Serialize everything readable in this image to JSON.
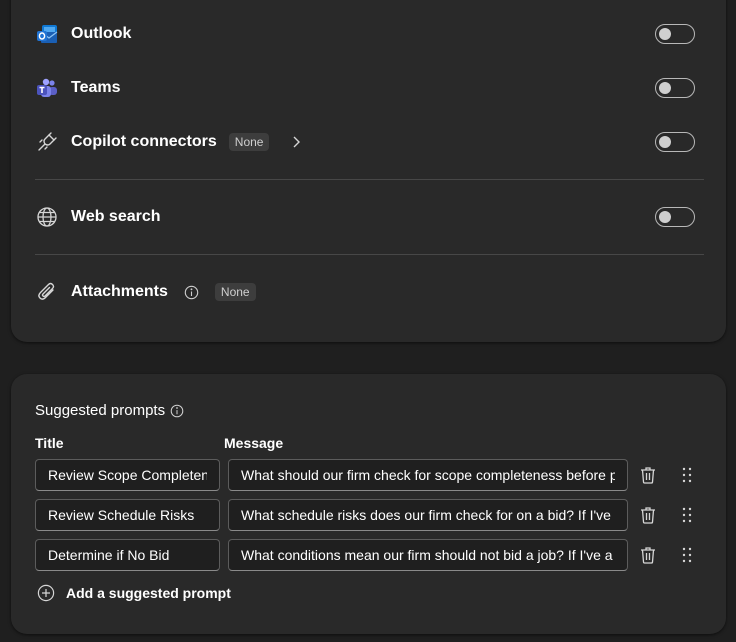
{
  "sources": {
    "outlook": {
      "label": "Outlook",
      "icon": "outlook-icon",
      "enabled": false
    },
    "teams": {
      "label": "Teams",
      "icon": "teams-icon",
      "enabled": false
    },
    "connectors": {
      "label": "Copilot connectors",
      "badge": "None",
      "icon": "connector-icon",
      "enabled": false
    },
    "web_search": {
      "label": "Web search",
      "icon": "globe-icon",
      "enabled": false
    },
    "attachments": {
      "label": "Attachments",
      "badge": "None",
      "icon": "paperclip-icon"
    }
  },
  "suggested_prompts": {
    "title": "Suggested prompts",
    "col_title": "Title",
    "col_message": "Message",
    "rows": [
      {
        "title": "Review Scope Completeness",
        "message": "What should our firm check for scope completeness before p"
      },
      {
        "title": "Review Schedule Risks",
        "message": "What schedule risks does our firm check for on a bid? If I've a"
      },
      {
        "title": "Determine if No Bid",
        "message": "What conditions mean our firm should not bid a job? If I've a"
      }
    ],
    "add_label": "Add a suggested prompt"
  },
  "colors": {
    "background": "#1f1f1f",
    "card": "#292929",
    "outlook_blue": "#1f6fd6",
    "teams_purple": "#6264a7"
  }
}
